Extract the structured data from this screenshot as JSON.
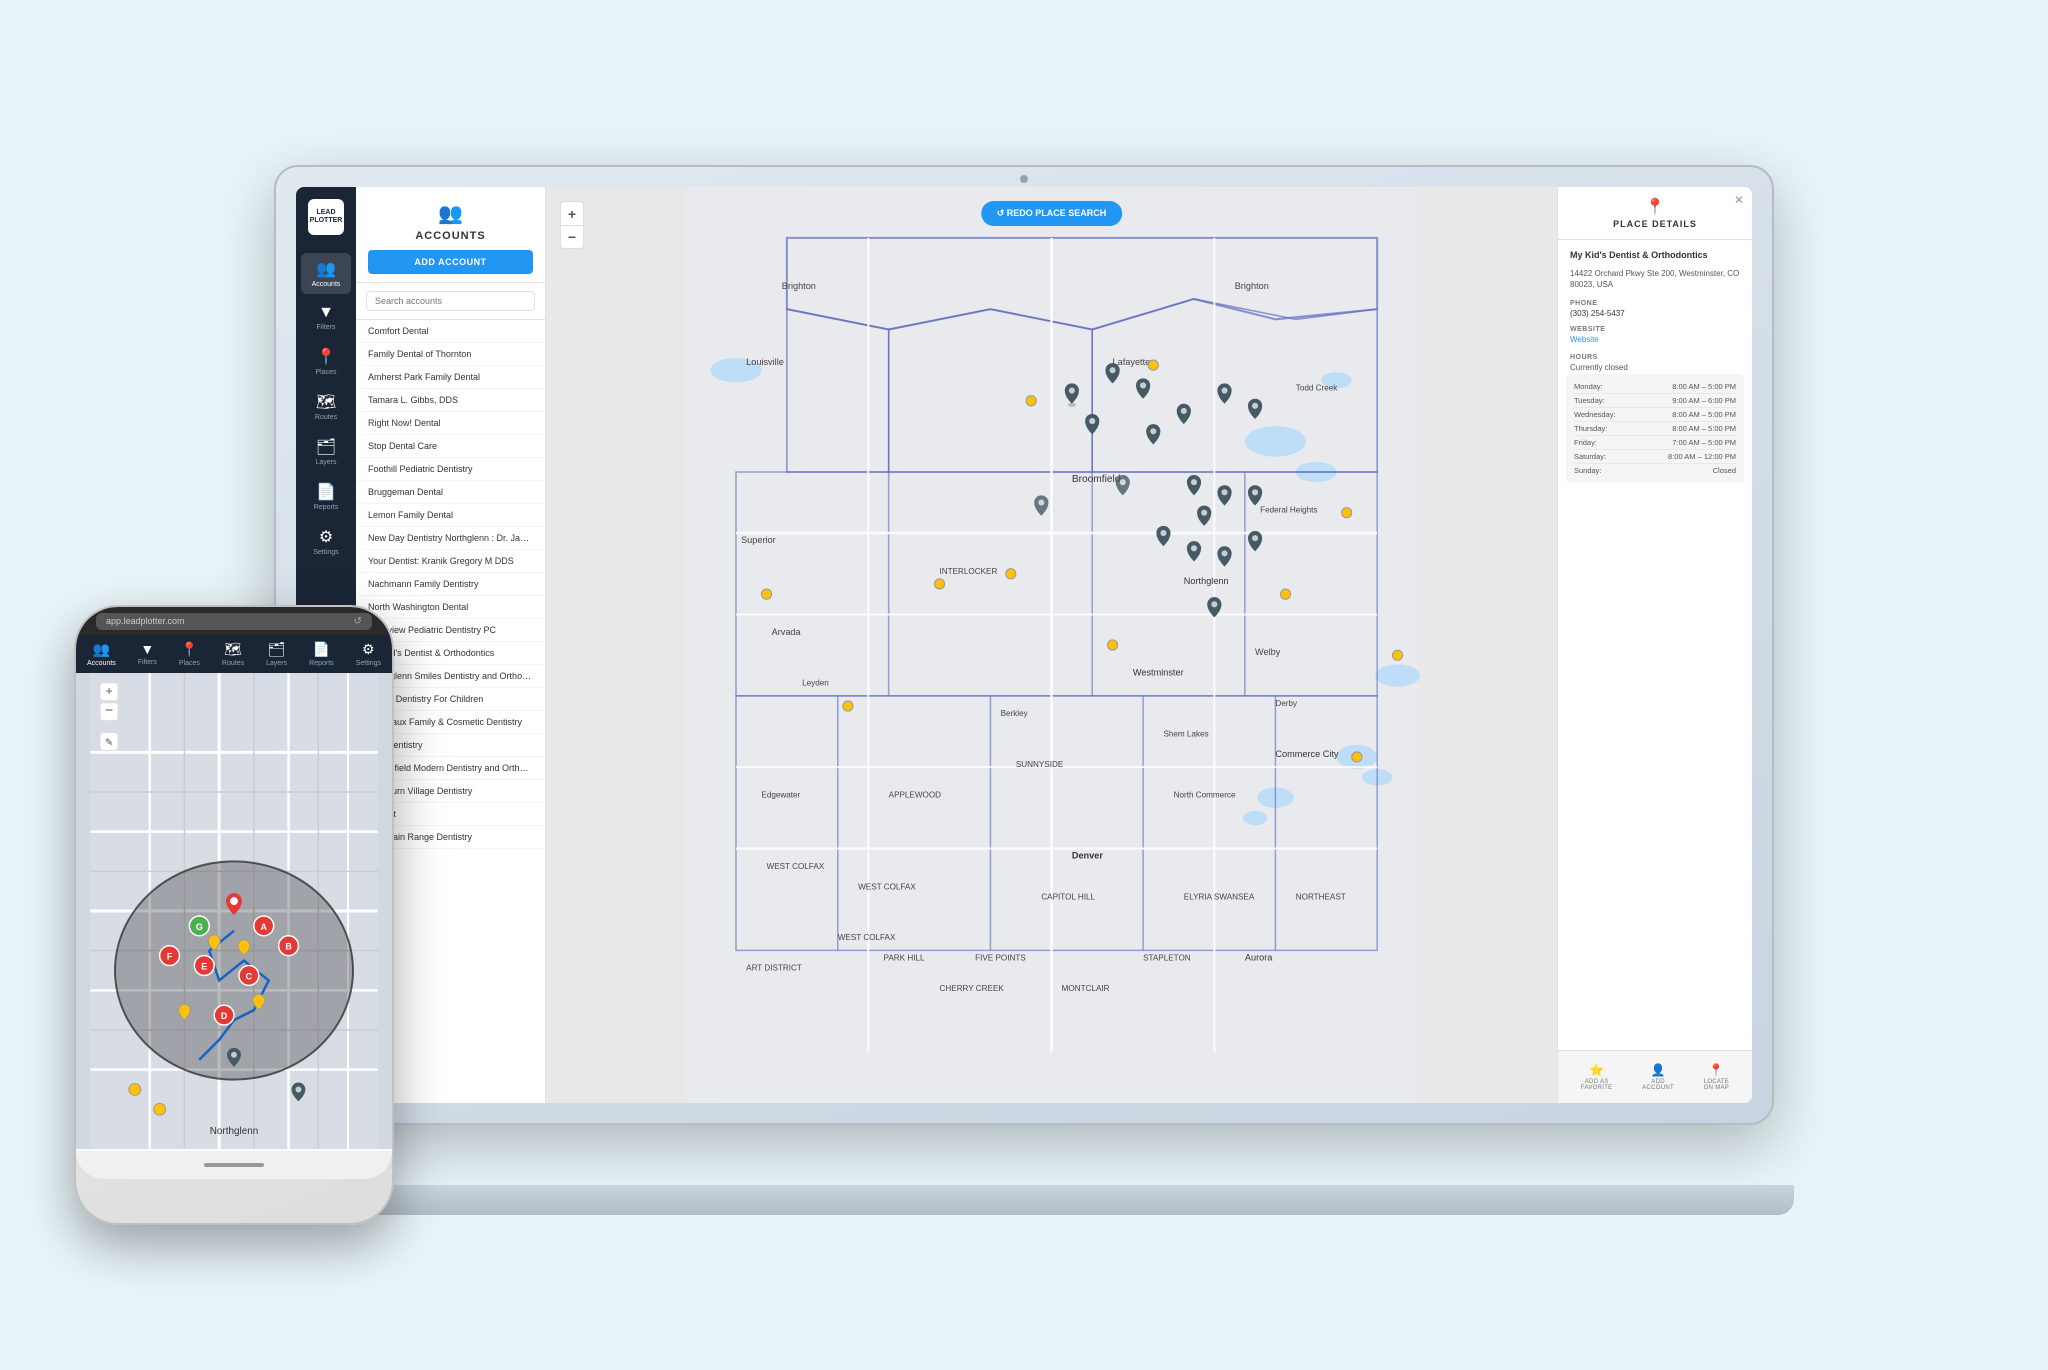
{
  "app": {
    "name": "LeadPlotter",
    "url": "app.leadplotter.com"
  },
  "sidebar": {
    "items": [
      {
        "label": "Accounts",
        "icon": "👥",
        "active": true
      },
      {
        "label": "Filters",
        "icon": "🔽",
        "active": false
      },
      {
        "label": "Places",
        "icon": "📍",
        "active": false
      },
      {
        "label": "Routes",
        "icon": "🗺",
        "active": false
      },
      {
        "label": "Layers",
        "icon": "🗂",
        "active": false
      },
      {
        "label": "Reports",
        "icon": "📄",
        "active": false
      },
      {
        "label": "Settings",
        "icon": "⚙",
        "active": false
      }
    ]
  },
  "accounts_panel": {
    "title": "ACCOUNTS",
    "add_button": "ADD ACCOUNT",
    "search_placeholder": "Search accounts",
    "items": [
      "Comfort Dental",
      "Family Dental of Thornton",
      "Amherst Park Family Dental",
      "Tamara L. Gibbs, DDS",
      "Right Now! Dental",
      "Stop Dental Care",
      "Foothill Pediatric Dentistry",
      "Bruggeman Dental",
      "Lemon Family Dental",
      "New Day Dentistry Northglenn : Dr. Jamie Suman & Dr...",
      "Your Dentist: Kranik Gregory M DDS",
      "Nachmann Family Dentistry",
      "North Washington Dental",
      "Lakeview Pediatric Dentistry PC",
      "My Kid's Dentist & Orthodontics",
      "Northglenn Smiles Dentistry and Orthodontics",
      "Young Dentistry For Children",
      "Chateaux Family & Cosmetic Dentistry",
      "Burt Dentistry",
      "Broomfield Modern Dentistry and Orthodontics",
      "Bradburn Village Dentistry",
      "Dentist",
      "Mountain Range Dentistry"
    ]
  },
  "map": {
    "redo_button": "↺ REDO PLACE SEARCH"
  },
  "place_details": {
    "title": "PLACE DETAILS",
    "name": "My Kid's Dentist & Orthodontics",
    "address": "14422 Orchard Pkwy Ste 200, Westminster, CO 80023, USA",
    "phone_label": "Phone",
    "phone": "(303) 254-5437",
    "website_label": "Website",
    "website": "Website",
    "hours_label": "HOURS",
    "hours_status": "Currently closed",
    "hours": [
      {
        "day": "Monday:",
        "time": "8:00 AM – 5:00 PM"
      },
      {
        "day": "Tuesday:",
        "time": "9:00 AM – 6:00 PM"
      },
      {
        "day": "Wednesday:",
        "time": "8:00 AM – 5:00 PM"
      },
      {
        "day": "Thursday:",
        "time": "8:00 AM – 5:00 PM"
      },
      {
        "day": "Friday:",
        "time": "7:00 AM – 5:00 PM"
      },
      {
        "day": "Saturday:",
        "time": "8:00 AM – 12:00 PM"
      },
      {
        "day": "Sunday:",
        "time": "Closed"
      }
    ],
    "footer_actions": [
      {
        "label": "ADD AS FAVORITE",
        "icon": "⭐"
      },
      {
        "label": "ADD ACCOUNT",
        "icon": "👤"
      },
      {
        "label": "LOCATE ON MAP",
        "icon": "📍"
      }
    ]
  },
  "mobile": {
    "url": "app.leadplotter.com",
    "toolbar_items": [
      {
        "label": "Accounts",
        "icon": "👥"
      },
      {
        "label": "Filters",
        "icon": "🔽"
      },
      {
        "label": "Places",
        "icon": "📍"
      },
      {
        "label": "Routes",
        "icon": "🗺"
      },
      {
        "label": "Layers",
        "icon": "🗂"
      },
      {
        "label": "Reports",
        "icon": "📄"
      },
      {
        "label": "Settings",
        "icon": "⚙"
      }
    ]
  }
}
